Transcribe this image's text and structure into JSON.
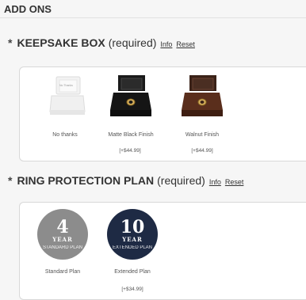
{
  "section": {
    "title": "ADD ONS"
  },
  "groups": {
    "keepsake": {
      "asterisk": "*",
      "title": "KEEPSAKE BOX",
      "required": "(required)",
      "info_label": "Info",
      "reset_label": "Reset",
      "options": [
        {
          "label": "No thanks",
          "price": "",
          "box_text": "No Thanks"
        },
        {
          "label": "Matte Black Finish",
          "price": "[+$44.99]"
        },
        {
          "label": "Walnut Finish",
          "price": "[+$44.99]"
        }
      ]
    },
    "protection": {
      "asterisk": "*",
      "title": "RING PROTECTION PLAN",
      "required": "(required)",
      "info_label": "Info",
      "reset_label": "Reset",
      "options": [
        {
          "label": "Standard Plan",
          "price": "",
          "badge_number": "4",
          "badge_year": "YEAR",
          "badge_sub": "STANDARD PLAN",
          "color": "#8c8c8c"
        },
        {
          "label": "Extended Plan",
          "price": "[+$34.99]",
          "badge_number": "10",
          "badge_year": "YEAR",
          "badge_sub": "EXTENDED PLAN",
          "color": "#1e2a44"
        }
      ]
    }
  }
}
